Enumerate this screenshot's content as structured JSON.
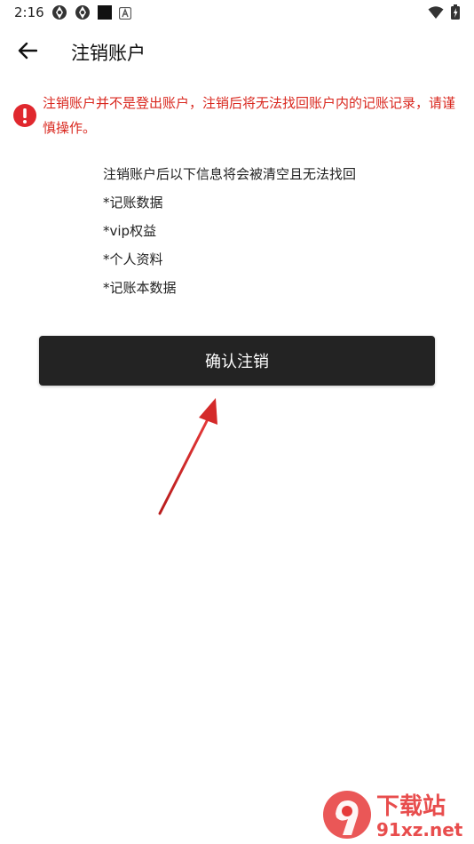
{
  "status_bar": {
    "time": "2:16",
    "left_icons": [
      "aperture-icon",
      "aperture-icon",
      "square-icon",
      "a-badge-icon"
    ],
    "right_icons": [
      "wifi-icon",
      "battery-charging-icon"
    ]
  },
  "app_bar": {
    "back_icon": "arrow-left-icon",
    "title": "注销账户"
  },
  "warning": {
    "icon": "exclamation-circle-icon",
    "text": "注销账户并不是登出账户，注销后将无法找回账户内的记账记录，请谨慎操作。",
    "color": "#d9281f"
  },
  "info": {
    "heading": "注销账户后以下信息将会被清空且无法找回",
    "items": [
      "*记账数据",
      "*vip权益",
      "*个人资料",
      "*记账本数据"
    ]
  },
  "confirm_button": {
    "label": "确认注销",
    "background": "#232323"
  },
  "annotation": {
    "type": "arrow",
    "color": "#d42a2a"
  },
  "watermark": {
    "logo_text": "9",
    "title": "下载站",
    "url": "91xz.net"
  }
}
